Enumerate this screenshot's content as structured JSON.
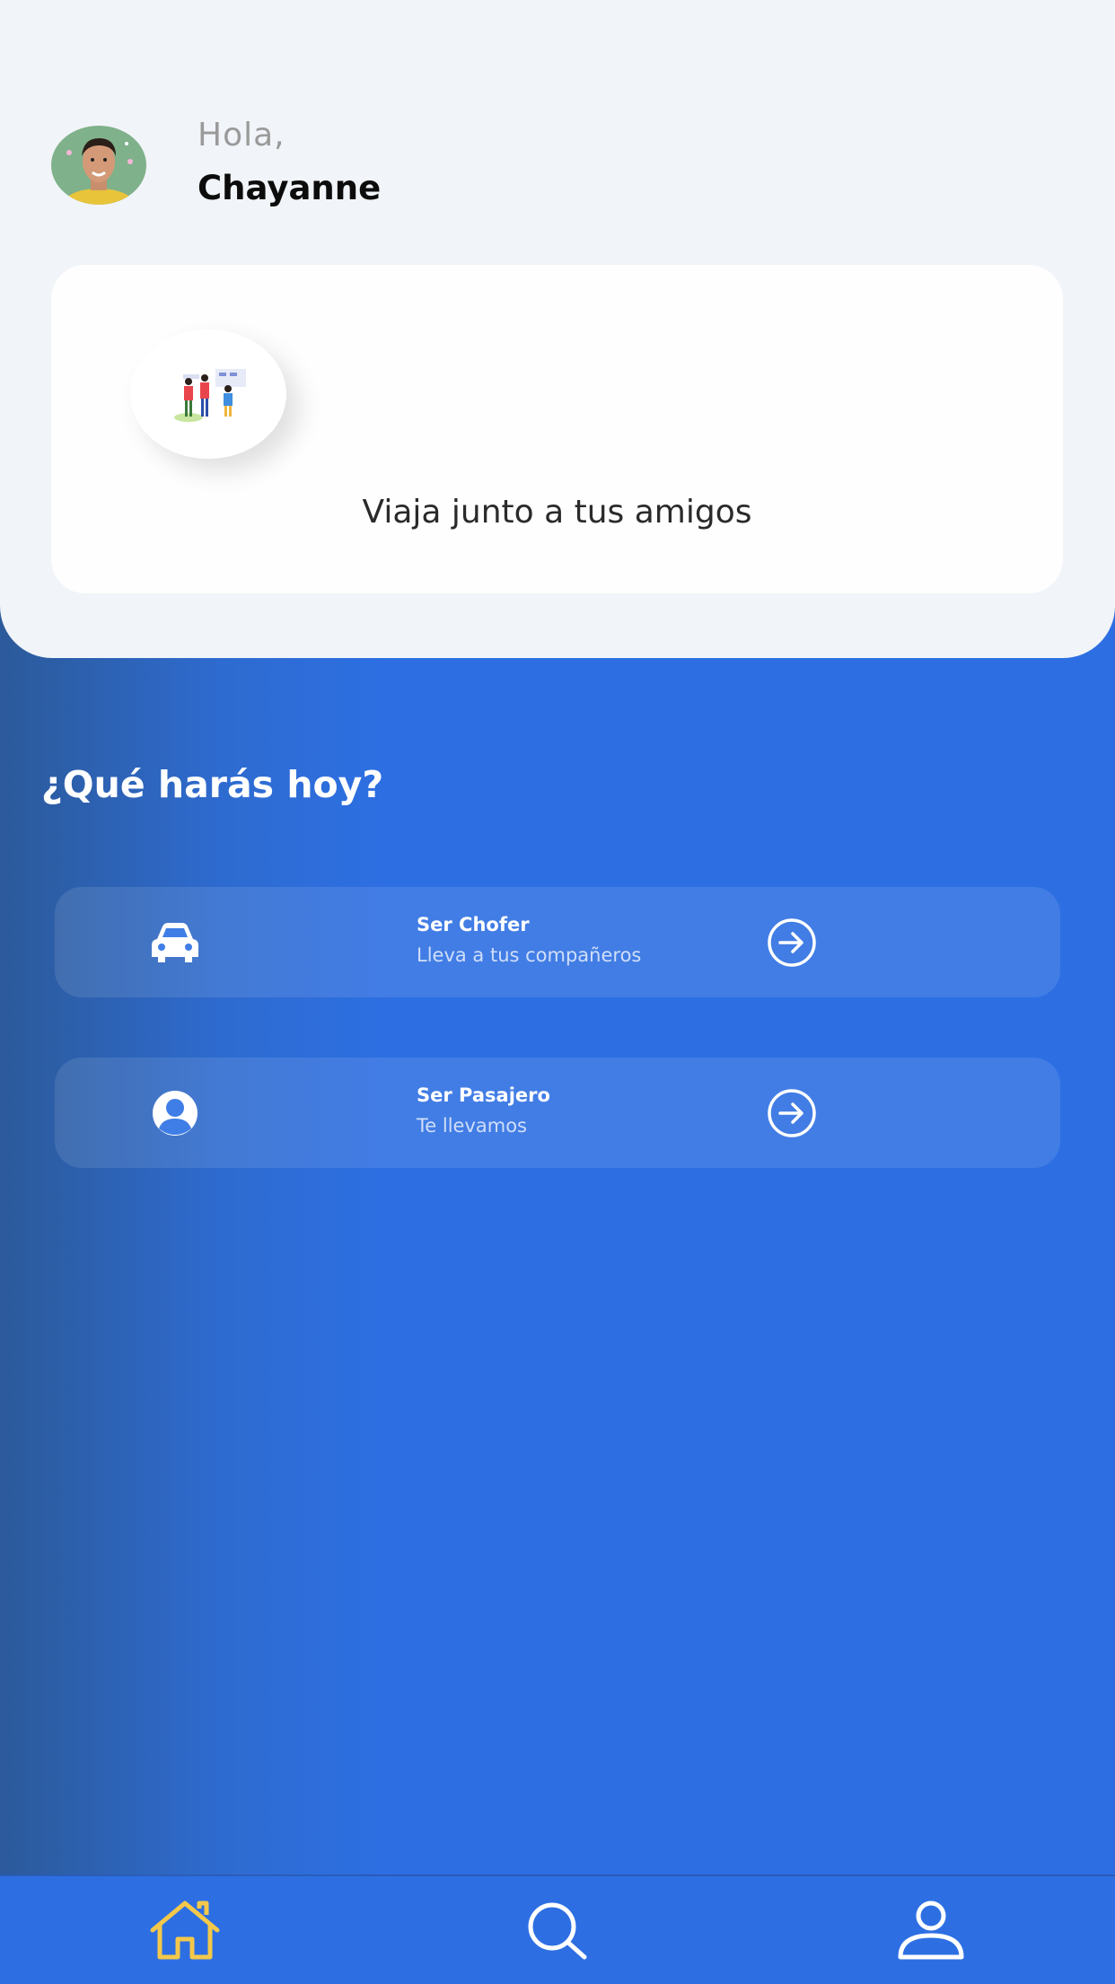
{
  "header": {
    "greeting": "Hola,",
    "user_name": "Chayanne"
  },
  "promo": {
    "text": "Viaja junto a tus amigos"
  },
  "main": {
    "question": "¿Qué harás hoy?",
    "options": [
      {
        "title": "Ser Chofer",
        "subtitle": "Lleva a tus compañeros",
        "icon": "car-icon"
      },
      {
        "title": "Ser Pasajero",
        "subtitle": "Te llevamos",
        "icon": "user-circle-icon"
      }
    ]
  },
  "nav": {
    "items": [
      {
        "icon": "home-icon",
        "active": true
      },
      {
        "icon": "search-icon",
        "active": false
      },
      {
        "icon": "profile-icon",
        "active": false
      }
    ]
  },
  "colors": {
    "primary_blue": "#2d6fe3",
    "active_nav": "#f4c84a",
    "panel_bg": "#f1f4f8"
  }
}
